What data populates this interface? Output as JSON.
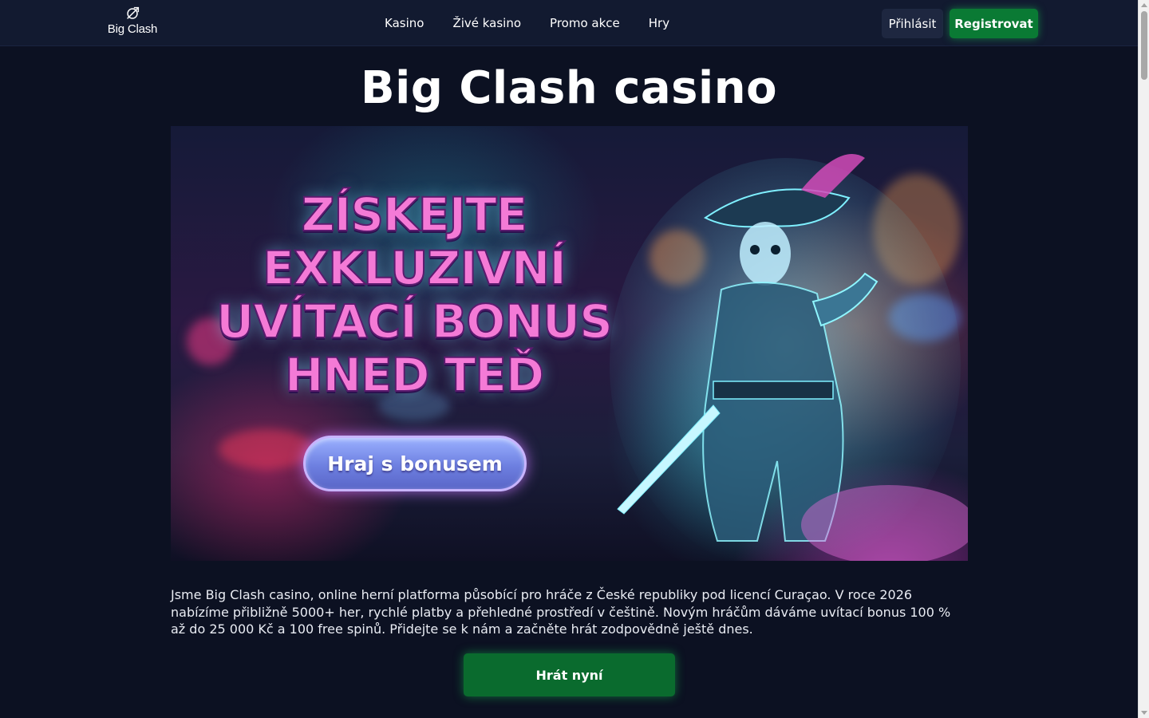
{
  "header": {
    "logo_text": "Big Clash",
    "nav": [
      {
        "label": "Kasino"
      },
      {
        "label": "Živé kasino"
      },
      {
        "label": "Promo akce"
      },
      {
        "label": "Hry"
      }
    ],
    "login_label": "Přihlásit",
    "register_label": "Registrovat"
  },
  "main": {
    "title": "Big Clash casino",
    "banner": {
      "headline_lines": [
        "ZÍSKEJTE",
        "EXKLUZIVNÍ",
        "UVÍTACÍ BONUS",
        "HNED TEĎ"
      ],
      "cta_label": "Hraj s bonusem"
    },
    "description": "Jsme Big Clash casino, online herní platforma působící pro hráče z České republiky pod licencí Curaçao. V roce 2026 nabízíme přibližně 5000+ her, rychlé platby a přehledné prostředí v češtině. Novým hráčům dáváme uvítací bonus 100 % až do 25 000 Kč a 100 free spinů. Přidejte se k nám a začněte hrát zodpovědně ještě dnes.",
    "play_label": "Hrát nyní"
  },
  "colors": {
    "background": "#0c1122",
    "header_bg": "#121a30",
    "accent_green": "#0a7a34",
    "login_bg": "#1e2740"
  }
}
